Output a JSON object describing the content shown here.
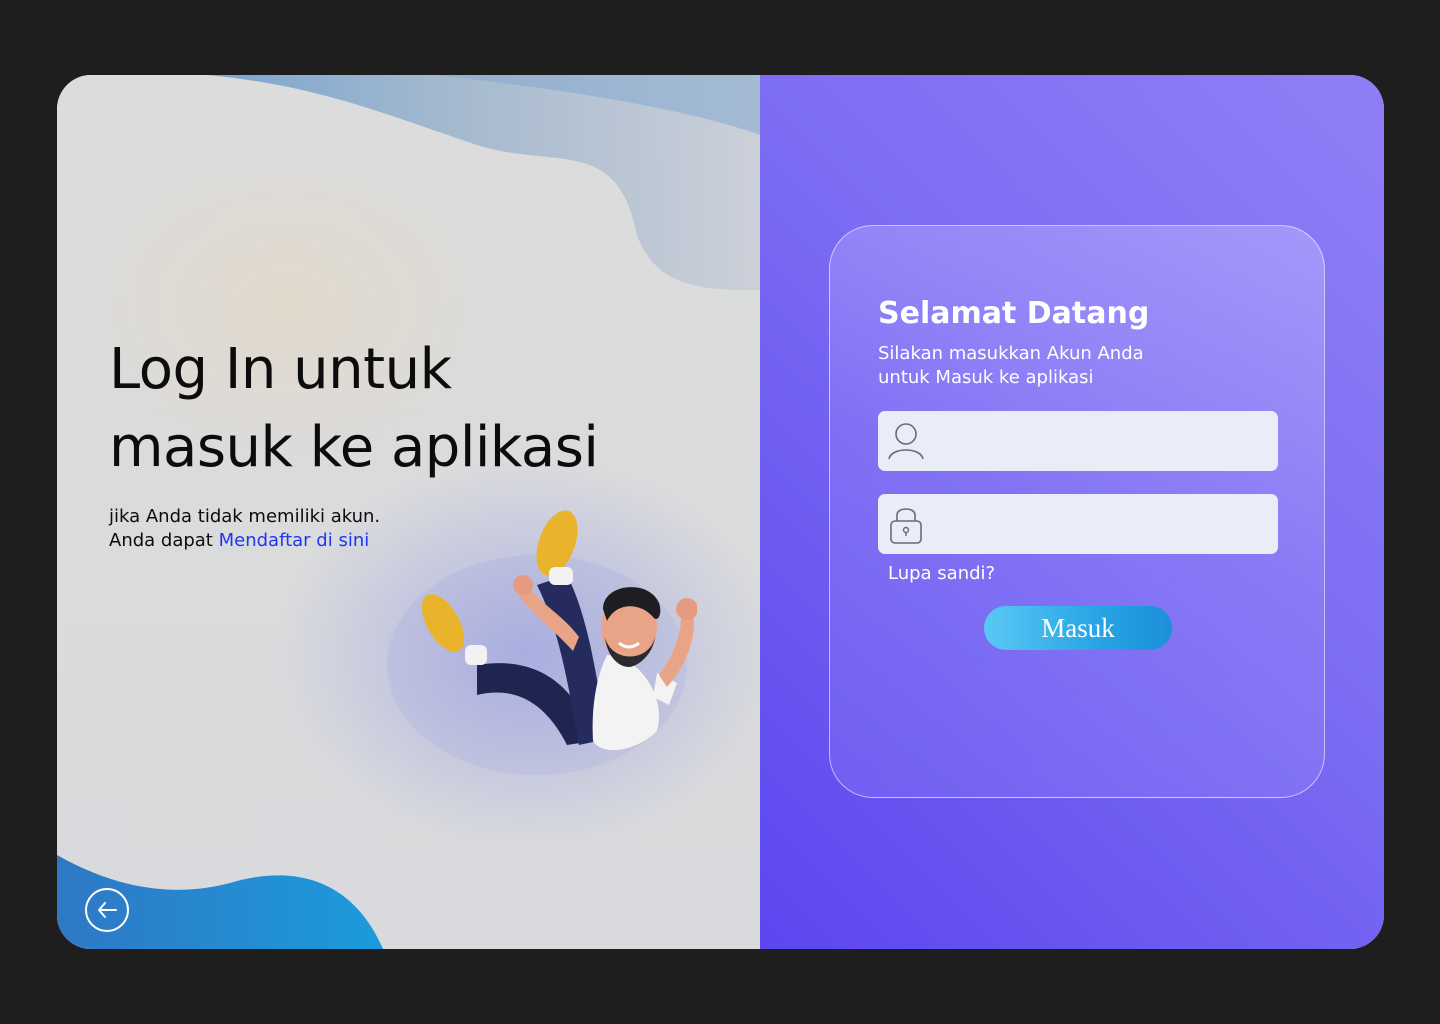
{
  "left": {
    "headline_line1": "Log In untuk",
    "headline_line2": "masuk ke aplikasi",
    "signup_line1": "jika Anda tidak memiliki akun.",
    "signup_prefix": "Anda dapat ",
    "signup_link": "Mendaftar di sini",
    "back_icon": "arrow-left-circle-icon"
  },
  "login": {
    "title": "Selamat Datang",
    "subtitle_line1": "Silakan masukkan Akun Anda",
    "subtitle_line2": "untuk Masuk ke aplikasi",
    "username_value": "",
    "password_value": "",
    "username_icon": "user-icon",
    "password_icon": "lock-icon",
    "forgot": "Lupa sandi?",
    "submit": "Masuk"
  },
  "colors": {
    "accent": "#5c46ef",
    "link": "#1f36f0",
    "button": "#29a4e6",
    "background": "#1e1e1f"
  }
}
